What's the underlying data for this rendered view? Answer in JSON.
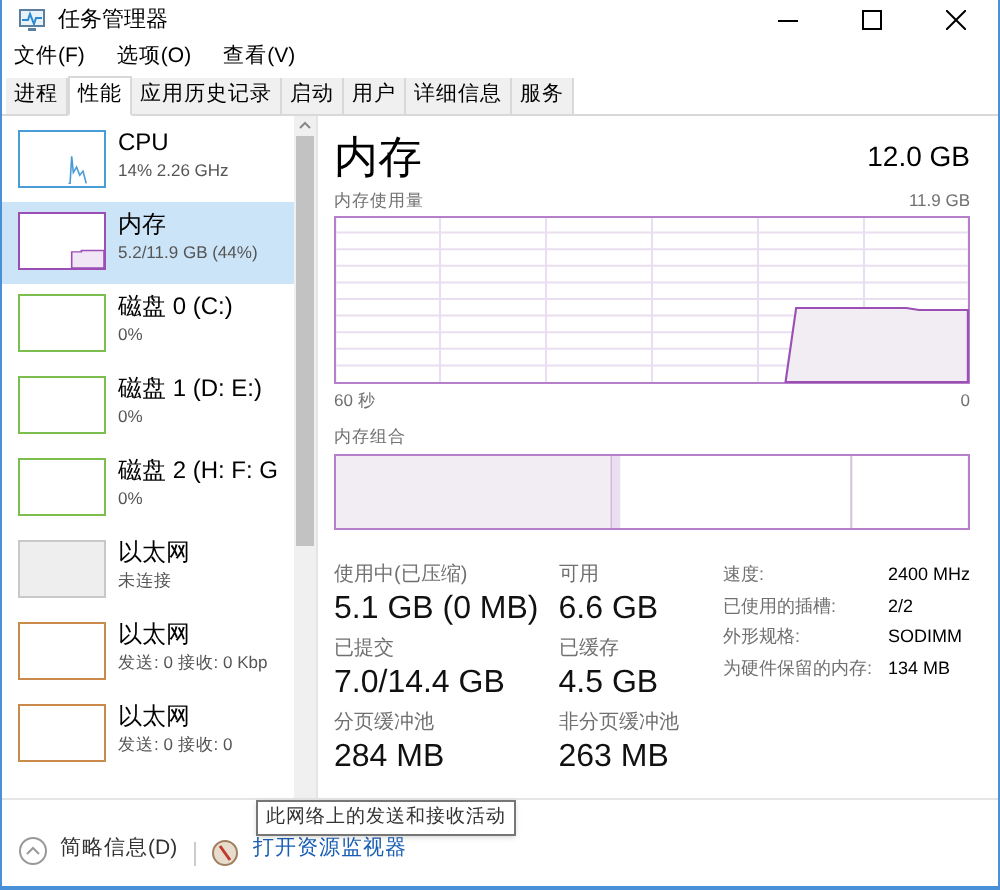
{
  "window": {
    "title": "任务管理器"
  },
  "menu": [
    "文件(F)",
    "选项(O)",
    "查看(V)"
  ],
  "tabs": [
    {
      "label": "进程",
      "selected": false
    },
    {
      "label": "性能",
      "selected": true
    },
    {
      "label": "应用历史记录",
      "selected": false
    },
    {
      "label": "启动",
      "selected": false
    },
    {
      "label": "用户",
      "selected": false
    },
    {
      "label": "详细信息",
      "selected": false
    },
    {
      "label": "服务",
      "selected": false
    }
  ],
  "sidebar": {
    "items": [
      {
        "kind": "cpu",
        "name": "CPU",
        "detail": "14% 2.26 GHz",
        "color": "#4a9cd6",
        "selected": false
      },
      {
        "kind": "memory",
        "name": "内存",
        "detail": "5.2/11.9 GB (44%)",
        "color": "#9b4fb5",
        "selected": true
      },
      {
        "kind": "disk",
        "name": "磁盘 0 (C:)",
        "detail": "0%",
        "color": "#7cbf4f",
        "selected": false
      },
      {
        "kind": "disk",
        "name": "磁盘 1 (D: E:)",
        "detail": "0%",
        "color": "#7cbf4f",
        "selected": false
      },
      {
        "kind": "disk",
        "name": "磁盘 2 (H: F: G",
        "detail": "0%",
        "color": "#7cbf4f",
        "selected": false
      },
      {
        "kind": "offline",
        "name": "以太网",
        "detail": "未连接",
        "color": "#c8c8c8",
        "selected": false
      },
      {
        "kind": "network",
        "name": "以太网",
        "detail": "发送: 0 接收: 0 Kbp",
        "color": "#c98a4b",
        "selected": false
      },
      {
        "kind": "network",
        "name": "以太网",
        "detail": "发送: 0 接收: 0",
        "color": "#c98a4b",
        "selected": false
      }
    ]
  },
  "panel": {
    "title": "内存",
    "total": "12.0 GB",
    "usage_label": "内存使用量",
    "usage_max": "11.9 GB",
    "time_start": "60 秒",
    "time_end": "0",
    "composition_label": "内存组合",
    "stats": [
      {
        "label": "使用中(已压缩)",
        "value": "5.1 GB (0 MB)"
      },
      {
        "label": "可用",
        "value": "6.6 GB"
      },
      {
        "label": "已提交",
        "value": "7.0/14.4 GB"
      },
      {
        "label": "已缓存",
        "value": "4.5 GB"
      },
      {
        "label": "分页缓冲池",
        "value": "284 MB"
      },
      {
        "label": "非分页缓冲池",
        "value": "263 MB"
      }
    ],
    "properties": [
      {
        "label": "速度:",
        "value": "2400 MHz"
      },
      {
        "label": "已使用的插槽:",
        "value": "2/2"
      },
      {
        "label": "外形规格:",
        "value": "SODIMM"
      },
      {
        "label": "为硬件保留的内存:",
        "value": "134 MB"
      }
    ]
  },
  "tooltip": "此网络上的发送和接收活动",
  "footer": {
    "summary": "简略信息(D)",
    "monitor_link": "打开资源监视器"
  }
}
